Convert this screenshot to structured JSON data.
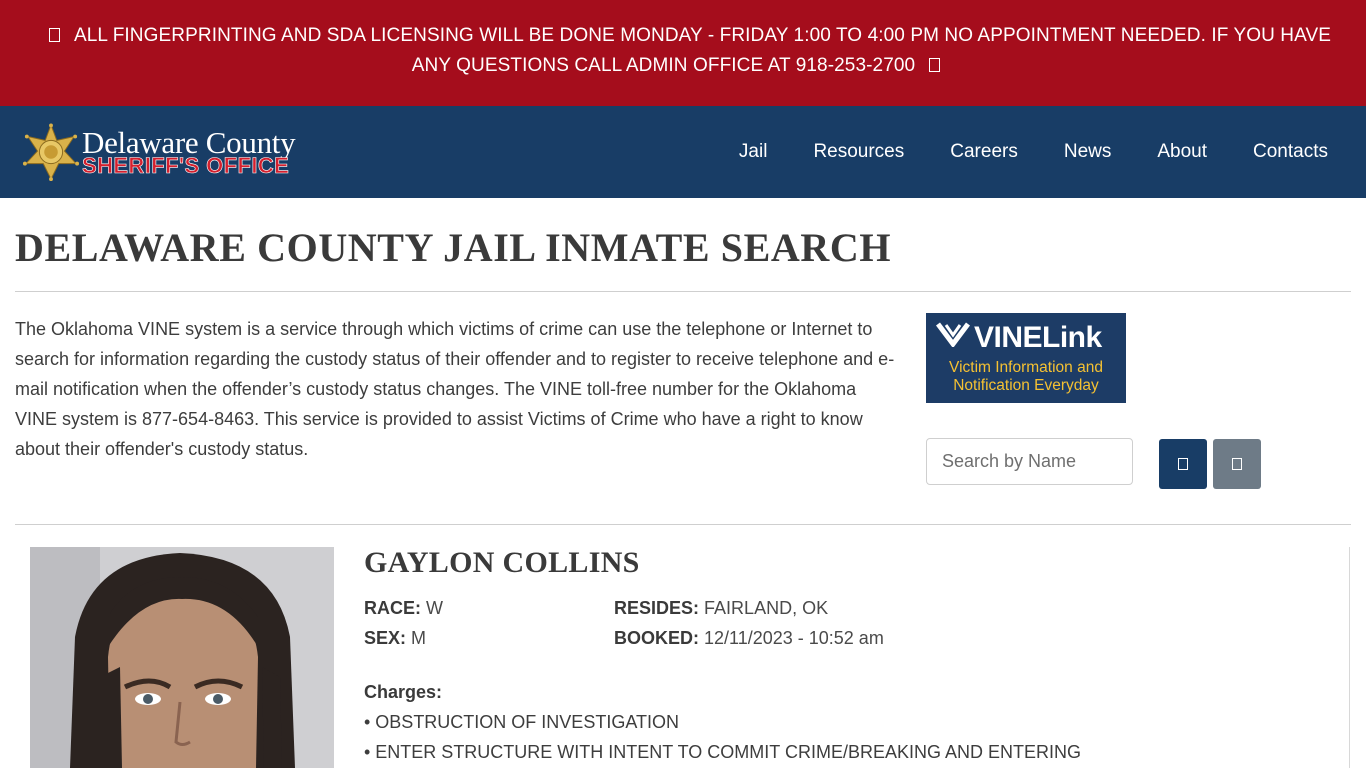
{
  "alert": {
    "text": "ALL FINGERPRINTING AND SDA LICENSING WILL BE DONE MONDAY - FRIDAY 1:00 TO 4:00 PM NO APPOINTMENT NEEDED. IF YOU HAVE ANY QUESTIONS CALL ADMIN OFFICE AT 918-253-2700",
    "bg_color": "#a50d1c"
  },
  "header": {
    "bg_color": "#183d66",
    "logo_line1": "Delaware County",
    "logo_line2": "SHERIFF'S OFFICE",
    "nav": [
      "Jail",
      "Resources",
      "Careers",
      "News",
      "About",
      "Contacts"
    ]
  },
  "page": {
    "title": "DELAWARE COUNTY JAIL INMATE SEARCH",
    "intro": "The Oklahoma VINE system is a service through which victims of crime can use the telephone or Internet to search for information regarding the custody status of their offender and to register to receive telephone and e-mail notification when the offender’s custody status changes. The VINE toll-free number for the Oklahoma VINE system is 877-654-8463. This service is provided to assist Victims of Crime who have a right to know about their offender's custody status."
  },
  "vine": {
    "brand": "VINELink",
    "tagline_1": "Victim Information and",
    "tagline_2": "Notification Everyday"
  },
  "search": {
    "placeholder": "Search by Name",
    "value": "",
    "search_icon": "search-icon",
    "clear_icon": "clear-icon"
  },
  "inmate": {
    "name": "GAYLON COLLINS",
    "race_label": "RACE:",
    "race": "W",
    "sex_label": "SEX:",
    "sex": "M",
    "resides_label": "RESIDES:",
    "resides": "FAIRLAND, OK",
    "booked_label": "BOOKED:",
    "booked": "12/11/2023 - 10:52 am",
    "charges_label": "Charges:",
    "charges": [
      "• OBSTRUCTION OF INVESTIGATION",
      "• ENTER STRUCTURE WITH INTENT TO COMMIT CRIME/BREAKING AND ENTERING"
    ]
  }
}
